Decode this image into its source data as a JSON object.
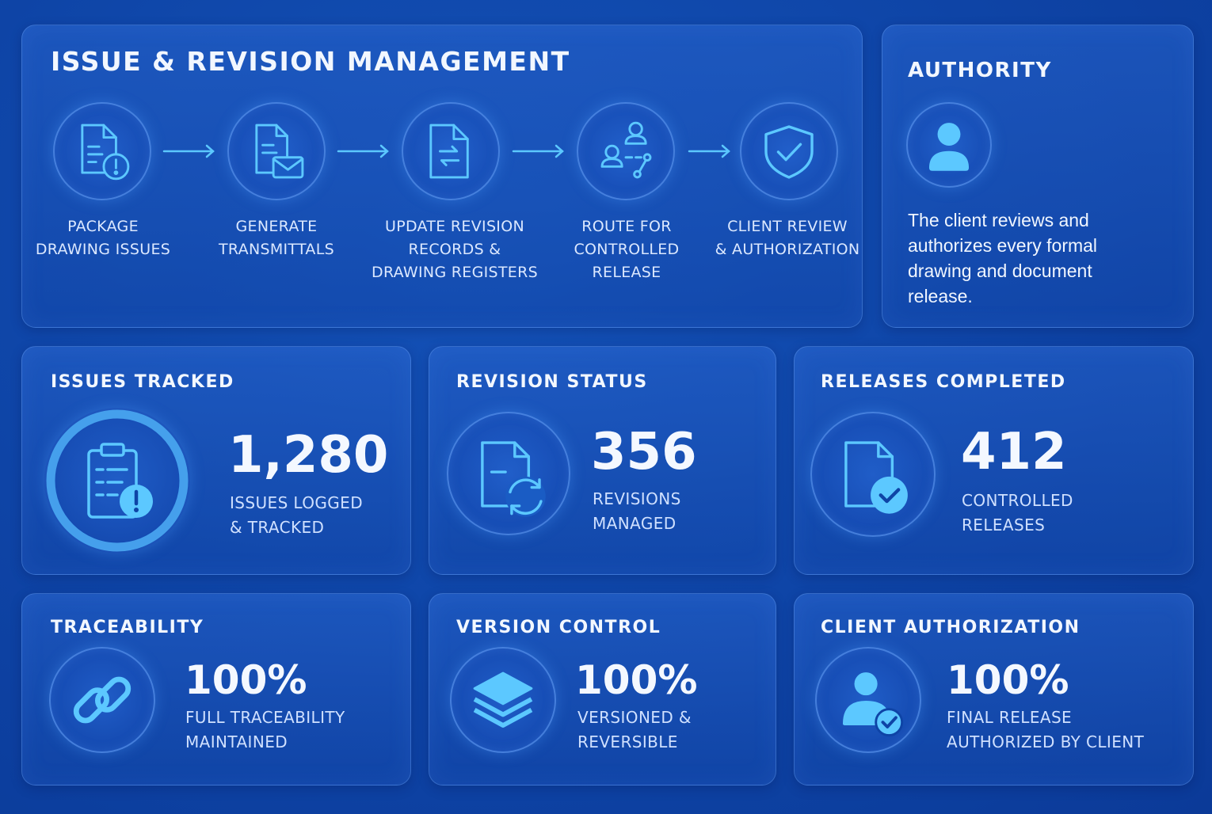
{
  "process": {
    "title": "ISSUE & REVISION MANAGEMENT",
    "steps": [
      {
        "label": "PACKAGE\nDRAWING ISSUES",
        "icon": "document-alert-icon"
      },
      {
        "label": "GENERATE\nTRANSMITTALS",
        "icon": "document-mail-icon"
      },
      {
        "label": "UPDATE REVISION\nRECORDS &\nDRAWING REGISTERS",
        "icon": "document-update-icon"
      },
      {
        "label": "ROUTE FOR\nCONTROLLED\nRELEASE",
        "icon": "routing-users-icon"
      },
      {
        "label": "CLIENT REVIEW\n& AUTHORIZATION",
        "icon": "shield-check-icon"
      }
    ]
  },
  "authority": {
    "title": "AUTHORITY",
    "icon": "user-icon",
    "text": "The client reviews and authorizes every formal drawing and document release."
  },
  "stats": {
    "issues": {
      "title": "ISSUES TRACKED",
      "value": "1,280",
      "caption": "ISSUES LOGGED\n& TRACKED",
      "icon": "clipboard-alert-icon"
    },
    "revisions": {
      "title": "REVISION STATUS",
      "value": "356",
      "caption": "REVISIONS\nMANAGED",
      "icon": "document-refresh-icon"
    },
    "releases": {
      "title": "RELEASES COMPLETED",
      "value": "412",
      "caption": "CONTROLLED\nRELEASES",
      "icon": "document-check-icon"
    },
    "traceability": {
      "title": "TRACEABILITY",
      "value": "100%",
      "caption": "FULL TRACEABILITY\nMAINTAINED",
      "icon": "link-icon"
    },
    "version": {
      "title": "VERSION CONTROL",
      "value": "100%",
      "caption": "VERSIONED &\nREVERSIBLE",
      "icon": "layers-icon"
    },
    "client": {
      "title": "CLIENT AUTHORIZATION",
      "value": "100%",
      "caption": "FINAL RELEASE\nAUTHORIZED BY CLIENT",
      "icon": "user-check-icon"
    }
  },
  "colors": {
    "accent": "#5cc8ff",
    "background": "#0e44a6"
  }
}
